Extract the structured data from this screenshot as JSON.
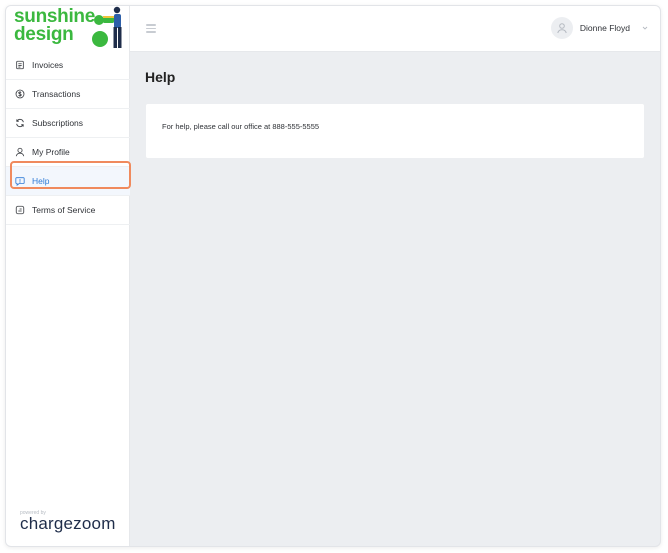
{
  "brand": {
    "logo_text_line1": "sunshine",
    "logo_text_line2": "design",
    "powered_by": "powered by",
    "provider": "chargezoom",
    "logo_color": "#3bb83f"
  },
  "sidebar": {
    "items": [
      {
        "label": "Invoices",
        "icon": "invoice-icon",
        "active": false
      },
      {
        "label": "Transactions",
        "icon": "dollar-circle-icon",
        "active": false
      },
      {
        "label": "Subscriptions",
        "icon": "refresh-icon",
        "active": false
      },
      {
        "label": "My Profile",
        "icon": "user-icon",
        "active": false
      },
      {
        "label": "Help",
        "icon": "help-chat-icon",
        "active": true
      },
      {
        "label": "Terms of Service",
        "icon": "document-icon",
        "active": false
      }
    ]
  },
  "header": {
    "menu_icon": "hamburger-icon",
    "user_name": "Dionne Floyd",
    "avatar_icon": "avatar-icon",
    "dropdown_icon": "chevron-down-icon"
  },
  "main": {
    "title": "Help",
    "help_text": "For help, please call our office at 888-555-5555"
  },
  "colors": {
    "accent": "#2e7ad6",
    "highlight": "#f08a5d",
    "background": "#eceef1"
  }
}
